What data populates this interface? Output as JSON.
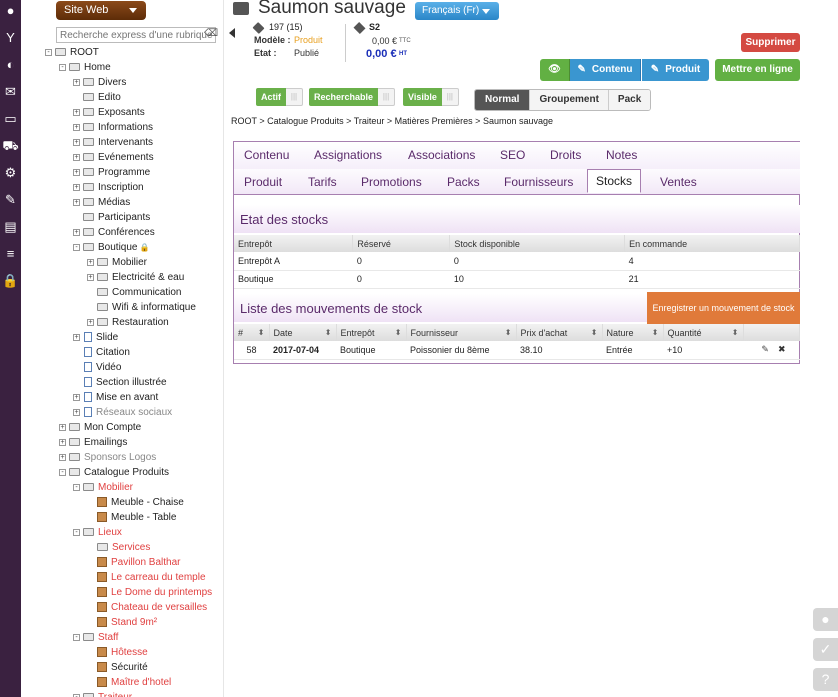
{
  "nav": {
    "icons": [
      "user-icon",
      "cocktail-icon",
      "bulb-icon",
      "mail-icon",
      "monitor-icon",
      "cart-icon",
      "cogs-icon",
      "wrench-icon",
      "document-icon",
      "list-icon",
      "lock-icon"
    ],
    "glyphs": [
      "●",
      "Y",
      "◐",
      "✉",
      "▭",
      "⛟",
      "⚙",
      "✎",
      "▤",
      "≡",
      "🔒"
    ]
  },
  "tree": {
    "site_button": "Site Web",
    "search_placeholder": "Recherche express d'une rubrique",
    "nodes": [
      {
        "label": "ROOT",
        "indent": 1,
        "type": "fold",
        "exp": "-",
        "color": ""
      },
      {
        "label": "Home",
        "indent": 2,
        "type": "fold",
        "exp": "-",
        "color": ""
      },
      {
        "label": "Divers",
        "indent": 3,
        "type": "fold",
        "exp": "+",
        "color": ""
      },
      {
        "label": "Edito",
        "indent": 3,
        "type": "fold",
        "exp": "",
        "color": ""
      },
      {
        "label": "Exposants",
        "indent": 3,
        "type": "fold",
        "exp": "+",
        "color": ""
      },
      {
        "label": "Informations",
        "indent": 3,
        "type": "fold",
        "exp": "+",
        "color": ""
      },
      {
        "label": "Intervenants",
        "indent": 3,
        "type": "fold",
        "exp": "+",
        "color": ""
      },
      {
        "label": "Evénements",
        "indent": 3,
        "type": "fold",
        "exp": "+",
        "color": ""
      },
      {
        "label": "Programme",
        "indent": 3,
        "type": "fold",
        "exp": "+",
        "color": ""
      },
      {
        "label": "Inscription",
        "indent": 3,
        "type": "fold",
        "exp": "+",
        "color": ""
      },
      {
        "label": "Médias",
        "indent": 3,
        "type": "fold",
        "exp": "+",
        "color": ""
      },
      {
        "label": "Participants",
        "indent": 3,
        "type": "fold",
        "exp": "",
        "color": ""
      },
      {
        "label": "Conférences",
        "indent": 3,
        "type": "fold",
        "exp": "+",
        "color": ""
      },
      {
        "label": "Boutique",
        "indent": 3,
        "type": "fold",
        "exp": "-",
        "color": "",
        "lock": true
      },
      {
        "label": "Mobilier",
        "indent": 4,
        "type": "fold",
        "exp": "+",
        "color": ""
      },
      {
        "label": "Electricité & eau",
        "indent": 4,
        "type": "fold",
        "exp": "+",
        "color": ""
      },
      {
        "label": "Communication",
        "indent": 4,
        "type": "fold",
        "exp": "",
        "color": ""
      },
      {
        "label": "Wifi & informatique",
        "indent": 4,
        "type": "fold",
        "exp": "",
        "color": ""
      },
      {
        "label": "Restauration",
        "indent": 4,
        "type": "fold",
        "exp": "+",
        "color": ""
      },
      {
        "label": "Slide",
        "indent": 3,
        "type": "doc",
        "exp": "+",
        "color": ""
      },
      {
        "label": "Citation",
        "indent": 3,
        "type": "doc",
        "exp": "",
        "color": ""
      },
      {
        "label": "Vidéo",
        "indent": 3,
        "type": "doc",
        "exp": "",
        "color": ""
      },
      {
        "label": "Section illustrée",
        "indent": 3,
        "type": "doc",
        "exp": "",
        "color": ""
      },
      {
        "label": "Mise en avant",
        "indent": 3,
        "type": "doc",
        "exp": "+",
        "color": ""
      },
      {
        "label": "Réseaux sociaux",
        "indent": 3,
        "type": "doc",
        "exp": "+",
        "color": "gray"
      },
      {
        "label": "Mon Compte",
        "indent": 2,
        "type": "fold",
        "exp": "+",
        "color": ""
      },
      {
        "label": "Emailings",
        "indent": 2,
        "type": "fold",
        "exp": "+",
        "color": ""
      },
      {
        "label": "Sponsors Logos",
        "indent": 2,
        "type": "fold",
        "exp": "+",
        "color": "gray"
      },
      {
        "label": "Catalogue Produits",
        "indent": 2,
        "type": "fold",
        "exp": "-",
        "color": ""
      },
      {
        "label": "Mobilier",
        "indent": 3,
        "type": "fold",
        "exp": "-",
        "color": "red"
      },
      {
        "label": "Meuble - Chaise",
        "indent": 4,
        "type": "box",
        "exp": "",
        "color": ""
      },
      {
        "label": "Meuble - Table",
        "indent": 4,
        "type": "box",
        "exp": "",
        "color": ""
      },
      {
        "label": "Lieux",
        "indent": 3,
        "type": "fold",
        "exp": "-",
        "color": "red"
      },
      {
        "label": "Services",
        "indent": 4,
        "type": "fold",
        "exp": "",
        "color": "red"
      },
      {
        "label": "Pavillon Balthar",
        "indent": 4,
        "type": "box",
        "exp": "",
        "color": "red"
      },
      {
        "label": "Le carreau du temple",
        "indent": 4,
        "type": "box",
        "exp": "",
        "color": "red"
      },
      {
        "label": "Le Dome du printemps",
        "indent": 4,
        "type": "box",
        "exp": "",
        "color": "red"
      },
      {
        "label": "Chateau de versailles",
        "indent": 4,
        "type": "box",
        "exp": "",
        "color": "red"
      },
      {
        "label": "Stand 9m²",
        "indent": 4,
        "type": "box",
        "exp": "",
        "color": "red"
      },
      {
        "label": "Staff",
        "indent": 3,
        "type": "fold",
        "exp": "-",
        "color": "red"
      },
      {
        "label": "Hôtesse",
        "indent": 4,
        "type": "box",
        "exp": "",
        "color": "red"
      },
      {
        "label": "Sécurité",
        "indent": 4,
        "type": "box",
        "exp": "",
        "color": ""
      },
      {
        "label": "Maître d'hotel",
        "indent": 4,
        "type": "box",
        "exp": "",
        "color": "red"
      },
      {
        "label": "Traiteur",
        "indent": 3,
        "type": "fold",
        "exp": "-",
        "color": "red"
      }
    ]
  },
  "header": {
    "title": "Saumon sauvage",
    "language": "Français (Fr)",
    "ref": "197 (15)",
    "modele_label": "Modèle :",
    "modele_value": "Produit",
    "etat_label": "Etat :",
    "etat_value": "Publié",
    "code": "S2",
    "price_ttc": "0,00 €",
    "ttc": "TTC",
    "price_ht": "0,00 €",
    "ht": "HT"
  },
  "actions": {
    "delete": "Supprimer",
    "view_icon": "👁",
    "contenu": "Contenu",
    "produit": "Produit",
    "online": "Mettre en ligne"
  },
  "toggles": {
    "actif": "Actif",
    "recherchable": "Recherchable",
    "visible": "Visible",
    "off_glyph": "|||"
  },
  "modes": [
    "Normal",
    "Groupement",
    "Pack"
  ],
  "breadcrumb": "ROOT > Catalogue Produits > Traiteur > Matières Premières > Saumon sauvage",
  "tabs_row1": [
    "Contenu",
    "Assignations",
    "Associations",
    "SEO",
    "Droits",
    "Notes"
  ],
  "tabs_row2": [
    "Produit",
    "Tarifs",
    "Promotions",
    "Packs",
    "Fournisseurs",
    "Stocks",
    "Ventes"
  ],
  "stock": {
    "title": "Etat des stocks",
    "headers": [
      "Entrepôt",
      "Réservé",
      "Stock disponible",
      "En commande"
    ],
    "rows": [
      [
        "Entrepôt A",
        "0",
        "0",
        "4"
      ],
      [
        "Boutique",
        "0",
        "10",
        "21"
      ]
    ]
  },
  "movements": {
    "title": "Liste des mouvements de stock",
    "record_button": "Enregistrer un mouvement de stock",
    "headers": [
      "#",
      "Date",
      "Entrepôt",
      "Fournisseur",
      "Prix d'achat",
      "Nature",
      "Quantité"
    ],
    "rows": [
      {
        "id": "58",
        "date": "2017-07-04",
        "entrepot": "Boutique",
        "fournisseur": "Poissonier du 8ème",
        "prix": "38.10",
        "nature": "Entrée",
        "quantite": "+10"
      }
    ]
  },
  "dock": [
    "●",
    "✓",
    "?"
  ]
}
